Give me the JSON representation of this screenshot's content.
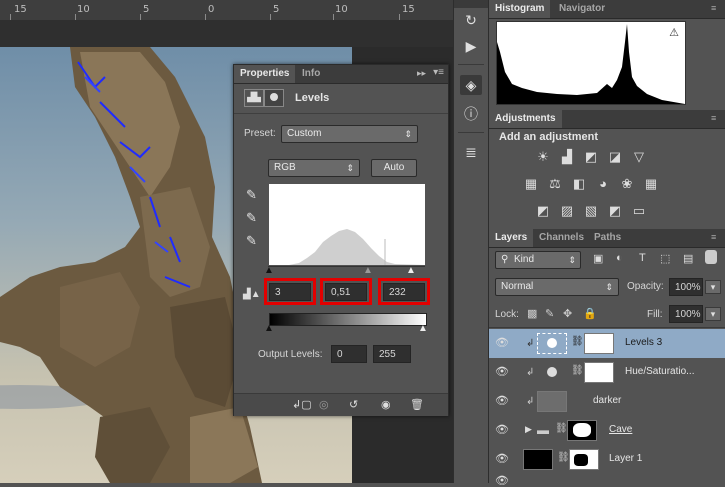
{
  "ruler": {
    "ticks": [
      "15",
      "10",
      "5",
      "0",
      "5",
      "10",
      "15"
    ]
  },
  "properties": {
    "tabs": [
      {
        "label": "Properties",
        "active": true
      },
      {
        "label": "Info",
        "active": false
      }
    ],
    "title": "Levels",
    "preset_label": "Preset:",
    "preset_value": "Custom",
    "channel_value": "RGB",
    "auto_label": "Auto",
    "input_levels": {
      "black": "3",
      "gamma": "0,51",
      "white": "232"
    },
    "output_label": "Output Levels:",
    "output_levels": {
      "low": "0",
      "high": "255"
    }
  },
  "histogram": {
    "tabs": [
      {
        "label": "Histogram",
        "active": true
      },
      {
        "label": "Navigator",
        "active": false
      }
    ]
  },
  "adjustments": {
    "tab": "Adjustments",
    "heading": "Add an adjustment"
  },
  "layers": {
    "tabs": [
      {
        "label": "Layers",
        "active": true
      },
      {
        "label": "Channels",
        "active": false
      },
      {
        "label": "Paths",
        "active": false
      }
    ],
    "filter_kind": "Kind",
    "blend_mode": "Normal",
    "opacity_label": "Opacity:",
    "opacity_value": "100%",
    "lock_label": "Lock:",
    "fill_label": "Fill:",
    "fill_value": "100%",
    "items": [
      {
        "name": "Levels 3"
      },
      {
        "name": "Hue/Saturatio..."
      },
      {
        "name": "darker"
      },
      {
        "name": "Cave"
      },
      {
        "name": "Layer 1"
      }
    ]
  },
  "colors": {
    "highlight_box": "#e30000",
    "selected_layer": "#8faac6",
    "panel_bg": "#535353"
  }
}
